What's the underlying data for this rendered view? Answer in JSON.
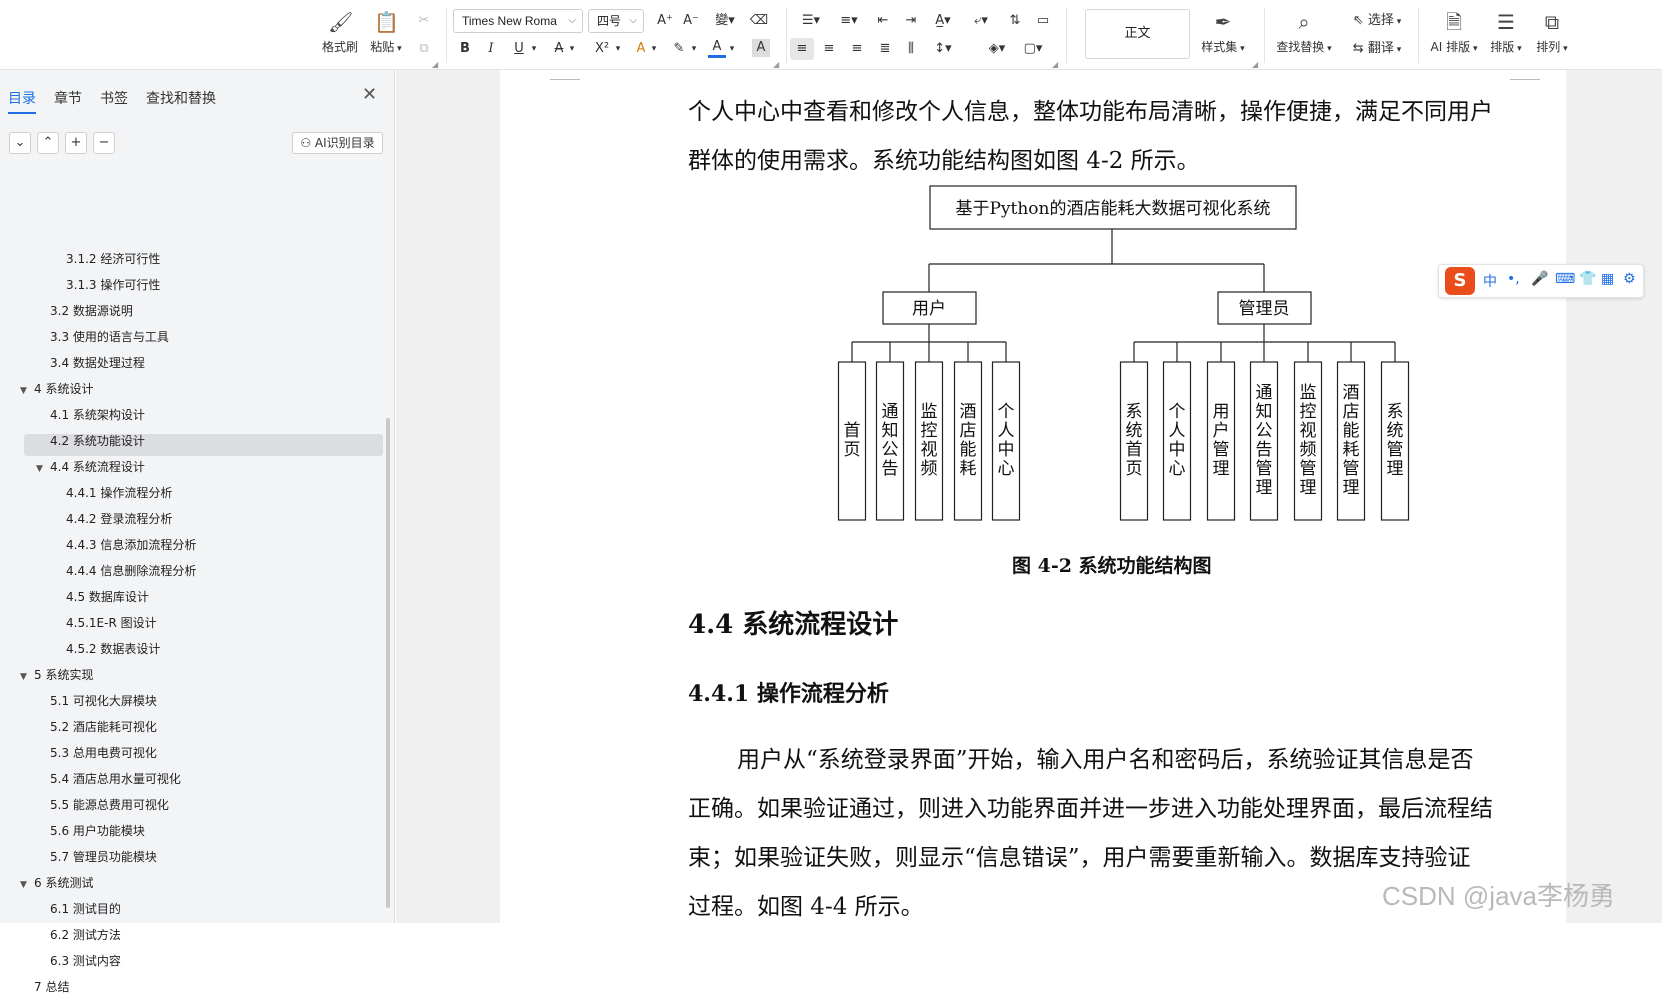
{
  "toolbar": {
    "format_painter": "格式刷",
    "paste": "粘贴",
    "font_name": "Times New Roma",
    "font_size": "四号",
    "style_current": "正文",
    "style_set": "样式集",
    "find_replace": "查找替换",
    "select": "选择",
    "translate": "翻译",
    "ai_layout": "AI 排版",
    "layout": "排版",
    "arrange": "排列",
    "bold": "B",
    "italic": "I",
    "underline": "U",
    "strike": "A",
    "superscript": "X²",
    "font_color_a": "A",
    "shading_a": "A",
    "accent_color": "#1e6fe5"
  },
  "sidebar": {
    "tabs": [
      "目录",
      "章节",
      "书签",
      "查找和替换"
    ],
    "ai_toc_button": "AI识别目录",
    "toc": [
      "3.1.2  经济可行性",
      "3.1.3  操作可行性",
      "3.2 数据源说明",
      "3.3 使用的语言与工具",
      "3.4 数据处理过程",
      "4 系统设计",
      "4.1 系统架构设计",
      "4.2 系统功能设计",
      "4.4 系统流程设计",
      "4.4.1 操作流程分析",
      "4.4.2 登录流程分析",
      "4.4.3 信息添加流程分析",
      "4.4.4 信息删除流程分析",
      "4.5 数据库设计",
      "4.5.1E-R 图设计",
      "4.5.2 数据表设计",
      "5 系统实现",
      "5.1 可视化大屏模块",
      "5.2 酒店能耗可视化",
      "5.3 总用电费可视化",
      "5.4 酒店总用水量可视化",
      "5.5 能源总费用可视化",
      "5.6 用户功能模块",
      "5.7 管理员功能模块",
      "6 系统测试",
      "6.1 测试目的",
      "6.2 测试方法",
      "6.3 测试内容",
      "7 总结"
    ]
  },
  "document": {
    "para1_line1": "个人中心中查看和修改个人信息，整体功能布局清晰，操作便捷，满足不同用户",
    "para1_line2": "群体的使用需求。系统功能结构图如图 4-2 所示。",
    "diagram": {
      "root": "基于Python的酒店能耗大数据可视化系统",
      "user": "用户",
      "admin": "管理员",
      "user_items": [
        "首页",
        "通知公告",
        "监控视频",
        "酒店能耗",
        "个人中心"
      ],
      "admin_items": [
        "系统首页",
        "个人中心",
        "用户管理",
        "通知公告管理",
        "监控视频管理",
        "酒店能耗管理",
        "系统管理"
      ]
    },
    "caption": "图 4-2 系统功能结构图",
    "heading_44": "4.4 系统流程设计",
    "heading_441": "4.4.1 操作流程分析",
    "para2_line1": "用户从“系统登录界面”开始，输入用户名和密码后，系统验证其信息是否",
    "para2_line2": "正确。如果验证通过，则进入功能界面并进一步进入功能处理界面，最后流程结",
    "para2_line3": "束；如果验证失败，则显示“信息错误”，用户需要重新输入。数据库支持验证",
    "para2_line4": "过程。如图 4-4 所示。",
    "watermark": "CSDN @java李杨勇"
  },
  "ime": {
    "chars": [
      "中",
      "•,",
      "🎤",
      "⌨",
      "👕",
      "▦",
      "⚙"
    ]
  }
}
